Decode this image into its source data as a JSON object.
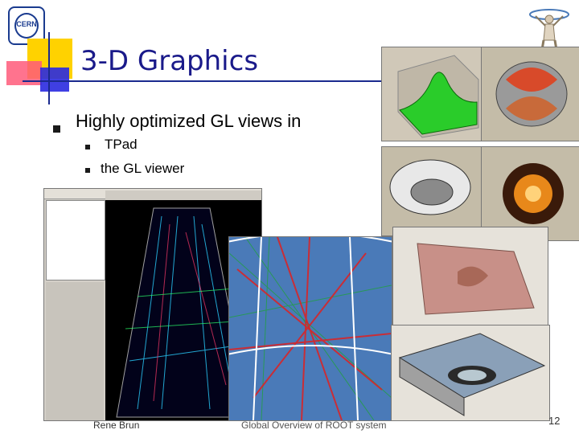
{
  "slide": {
    "title": "3-D Graphics",
    "bullets": [
      {
        "text": "Highly optimized GL views in"
      },
      {
        "text": "TPad"
      },
      {
        "text": "the GL viewer"
      }
    ],
    "footer": {
      "author": "Rene Brun",
      "center": "Global Overview of ROOT system",
      "page": "12"
    }
  },
  "colors": {
    "title": "#1a1a8a",
    "accent_yellow": "#ffd200",
    "accent_red": "#ff5a7a",
    "accent_blue": "#2a2ae0"
  },
  "icons": {
    "logo": "cern-logo",
    "statue": "statue-icon"
  }
}
